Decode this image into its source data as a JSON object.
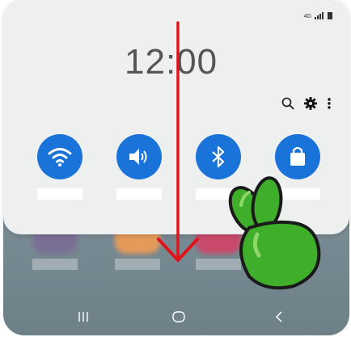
{
  "status_bar": {
    "network": "4G",
    "signal_icon": "signal-icon",
    "battery_icon": "battery-icon"
  },
  "clock": {
    "time": "12:00"
  },
  "toolbar": {
    "icons": [
      "search-icon",
      "gear-icon",
      "more-vert-icon"
    ]
  },
  "quick_tiles": [
    {
      "name": "wifi",
      "icon": "wifi-icon",
      "active": true
    },
    {
      "name": "sound",
      "icon": "volume-icon",
      "active": true
    },
    {
      "name": "bluetooth",
      "icon": "bluetooth-icon",
      "active": true
    },
    {
      "name": "secure-folder",
      "icon": "lock-icon",
      "active": true
    }
  ],
  "nav_bar": {
    "buttons": [
      "recents-button",
      "home-button",
      "back-button"
    ]
  },
  "overlay": {
    "gesture": "swipe-down",
    "arrow_color": "#e0141b",
    "hand_color": "#3fae2a"
  },
  "colors": {
    "tile_blue": "#1a73d9",
    "panel_bg": "#eeefef"
  }
}
